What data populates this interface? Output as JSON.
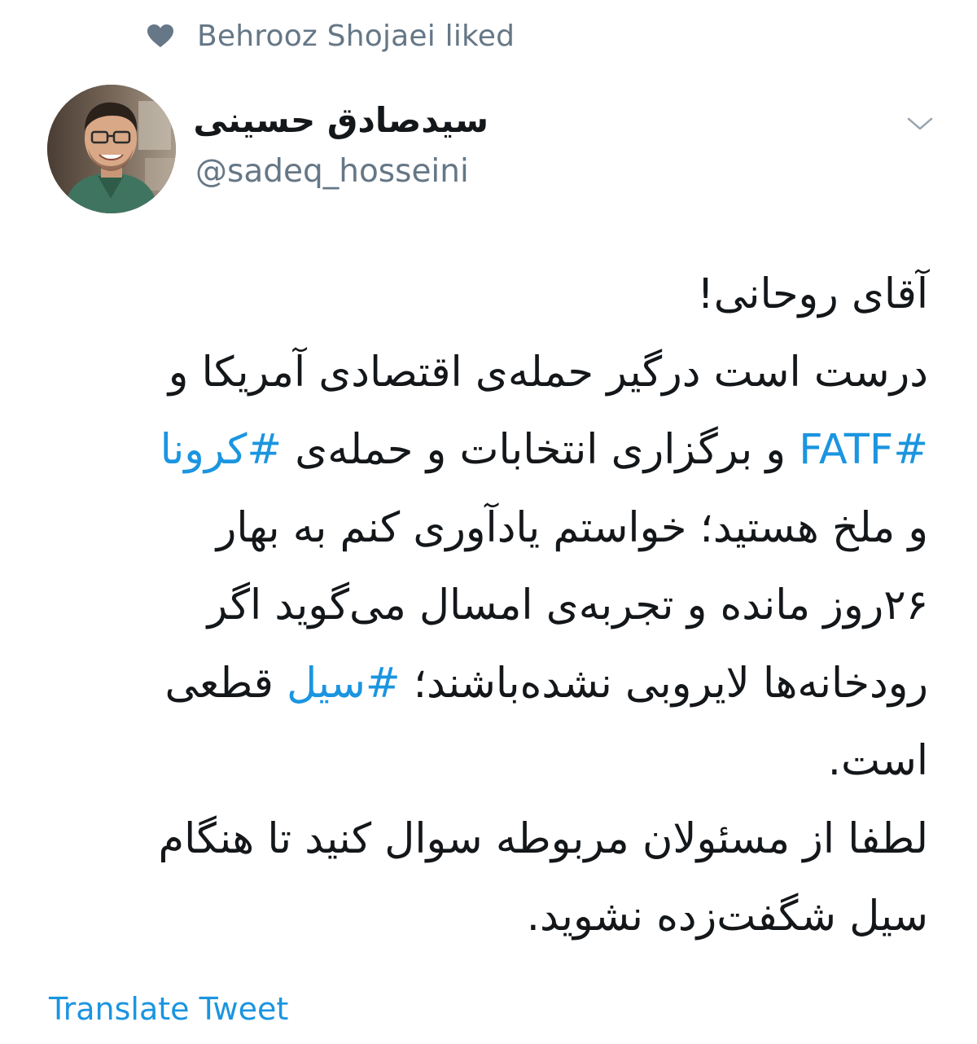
{
  "social_context": {
    "text": "Behrooz Shojaei liked",
    "icon": "heart-icon"
  },
  "author": {
    "display_name": "سیدصادق حسینی",
    "handle": "@sadeq_hosseini",
    "avatar": "avatar-photo"
  },
  "menu": {
    "icon": "chevron-down-icon"
  },
  "tweet": {
    "lines": [
      [
        {
          "text": "آقای روحانی!",
          "type": "text"
        }
      ],
      [
        {
          "text": "درست است درگیر حمله‌ی اقتصادی آمریکا و",
          "type": "text"
        }
      ],
      [
        {
          "text": "#FATF",
          "type": "hashtag"
        },
        {
          "text": " و برگزاری انتخابات و حمله‌ی ",
          "type": "text"
        },
        {
          "text": "#کرونا",
          "type": "hashtag"
        }
      ],
      [
        {
          "text": "و ملخ هستید؛ خواستم یادآوری کنم به بهار",
          "type": "text"
        }
      ],
      [
        {
          "text": "۲۶روز مانده و تجربه‌ی امسال می‌گوید اگر",
          "type": "text"
        }
      ],
      [
        {
          "text": "رودخانه‌ها لایروبی نشده‌باشند؛ ",
          "type": "text"
        },
        {
          "text": "#سیل",
          "type": "hashtag"
        },
        {
          "text": " قطعی",
          "type": "text"
        }
      ],
      [
        {
          "text": "است.",
          "type": "text"
        }
      ],
      [
        {
          "text": "لطفا از مسئولان مربوطه سوال کنید تا هنگام",
          "type": "text"
        }
      ],
      [
        {
          "text": "سیل شگفت‌زده نشوید.",
          "type": "text"
        }
      ]
    ]
  },
  "translate_label": "Translate Tweet",
  "colors": {
    "link": "#1b95e0",
    "secondary": "#657786",
    "primary_text": "#14171a"
  }
}
